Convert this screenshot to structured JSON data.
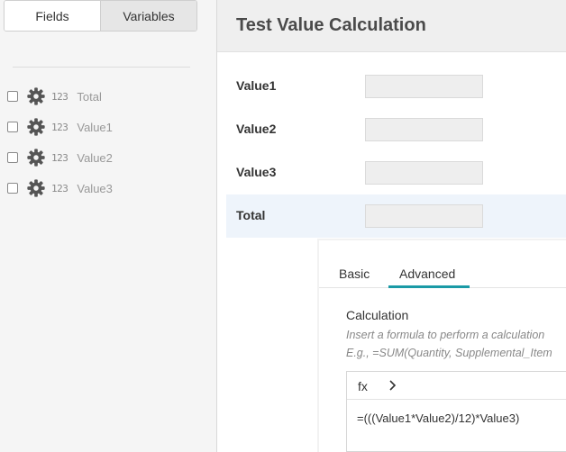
{
  "toggle": {
    "fields_label": "Fields",
    "variables_label": "Variables"
  },
  "variables": [
    {
      "type_icon": "123",
      "name": "Total"
    },
    {
      "type_icon": "123",
      "name": "Value1"
    },
    {
      "type_icon": "123",
      "name": "Value2"
    },
    {
      "type_icon": "123",
      "name": "Value3"
    }
  ],
  "form": {
    "title": "Test Value Calculation",
    "rows": [
      {
        "label": "Value1",
        "value": ""
      },
      {
        "label": "Value2",
        "value": ""
      },
      {
        "label": "Value3",
        "value": ""
      },
      {
        "label": "Total",
        "value": ""
      }
    ],
    "selected_row": "Total"
  },
  "properties": {
    "tabs": {
      "basic": "Basic",
      "advanced": "Advanced",
      "active": "Advanced"
    },
    "calculation_title": "Calculation",
    "help_line1": "Insert a formula to perform a calculation",
    "help_line2": "E.g., =SUM(Quantity, Supplemental_Item",
    "fx_label": "fx",
    "formula": "=(((Value1*Value2)/12)*Value3)"
  },
  "colors": {
    "accent_tab_underline": "#1a9aa6",
    "selected_row_bg": "#eef4fb",
    "header_bg": "#efefef",
    "left_panel_bg": "#f5f5f5"
  },
  "icons": {
    "settings": "gear-icon",
    "number_type": "number-type-icon",
    "expand": "chevron-right-icon"
  }
}
